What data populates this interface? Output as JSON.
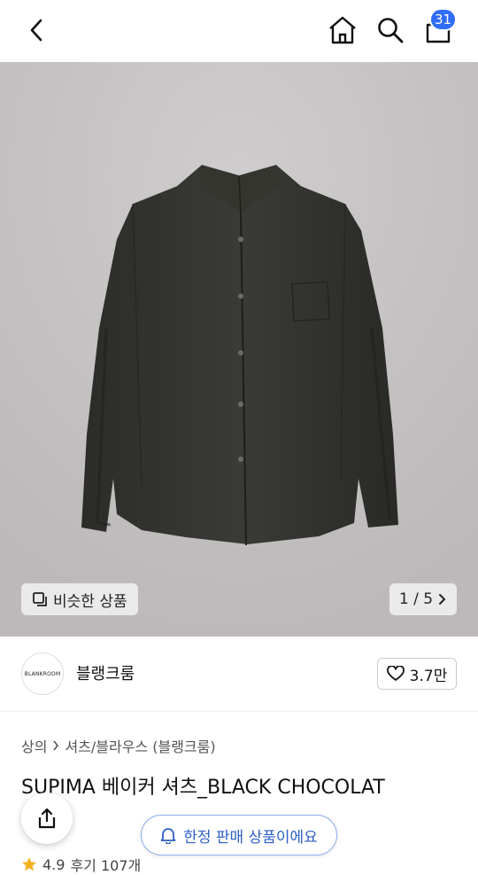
{
  "header": {
    "back_icon": "chevron-left-icon",
    "home_icon": "home-icon",
    "search_icon": "search-icon",
    "bag_icon": "shopping-bag-icon",
    "cart_count": "31"
  },
  "gallery": {
    "similar_label": "비슷한 상품",
    "page_indicator": "1 / 5",
    "shirt_label": "BLANKROOM"
  },
  "brand": {
    "logo_text": "BLANKROOM",
    "name": "블랭크룸",
    "likes": "3.7만"
  },
  "breadcrumb": {
    "level1": "상의",
    "level2": "셔츠/블라우스 (블랭크룸)"
  },
  "product": {
    "title": "SUPIMA 베이커 셔츠_BLACK CHOCOLAT",
    "rating": "4.9",
    "reviews": "후기 107개"
  },
  "badges": {
    "limited_label": "한정 판매 상품이에요"
  },
  "colors": {
    "accent": "#2f6df6",
    "pill_text": "#2d5fc4"
  }
}
